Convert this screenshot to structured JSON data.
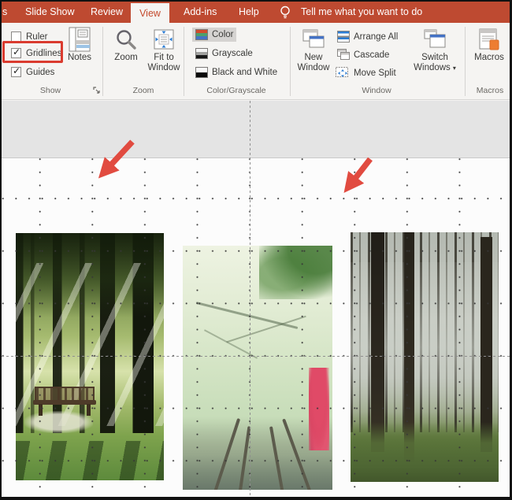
{
  "tab_bar": {
    "partial_tab": "s",
    "tabs": [
      {
        "label": "Slide Show",
        "active": false
      },
      {
        "label": "Review",
        "active": false
      },
      {
        "label": "View",
        "active": true
      },
      {
        "label": "Add-ins",
        "active": false
      },
      {
        "label": "Help",
        "active": false
      }
    ],
    "tell_me": "Tell me what you want to do"
  },
  "ribbon": {
    "show": {
      "group_label": "Show",
      "ruler": "Ruler",
      "gridlines": "Gridlines",
      "guides": "Guides",
      "notes": "Notes",
      "ruler_checked": false,
      "gridlines_checked": true,
      "guides_checked": true,
      "gridlines_highlighted": true
    },
    "zoom": {
      "group_label": "Zoom",
      "zoom": "Zoom",
      "fit_to_window": "Fit to Window"
    },
    "color_grayscale": {
      "group_label": "Color/Grayscale",
      "color": "Color",
      "grayscale": "Grayscale",
      "black_and_white": "Black and White",
      "selected": "Color"
    },
    "window": {
      "group_label": "Window",
      "new_window": "New Window",
      "arrange_all": "Arrange All",
      "cascade": "Cascade",
      "move_split": "Move Split",
      "switch_windows": "Switch Windows"
    },
    "macros": {
      "group_label": "Macros",
      "macros": "Macros"
    }
  },
  "icons": {
    "check": "✓",
    "caret_down": "▾"
  },
  "canvas": {
    "gridlines_visible": true,
    "guides_visible": true,
    "images": [
      {
        "description": "sunlit park with trees and bench"
      },
      {
        "description": "misty green forest over railway tracks with red blossoms"
      },
      {
        "description": "tall foggy forest trunks on grassy ground"
      }
    ]
  },
  "colors": {
    "ribbon_red": "#BE4A31",
    "active_tab_text": "#C4492C",
    "highlight_box": "#DA3B2F",
    "arrow_red": "#E14B40",
    "selected_item_bg": "#D5D3D1",
    "grid_dot": "#373737",
    "guide_gray": "#8F8F8F"
  }
}
